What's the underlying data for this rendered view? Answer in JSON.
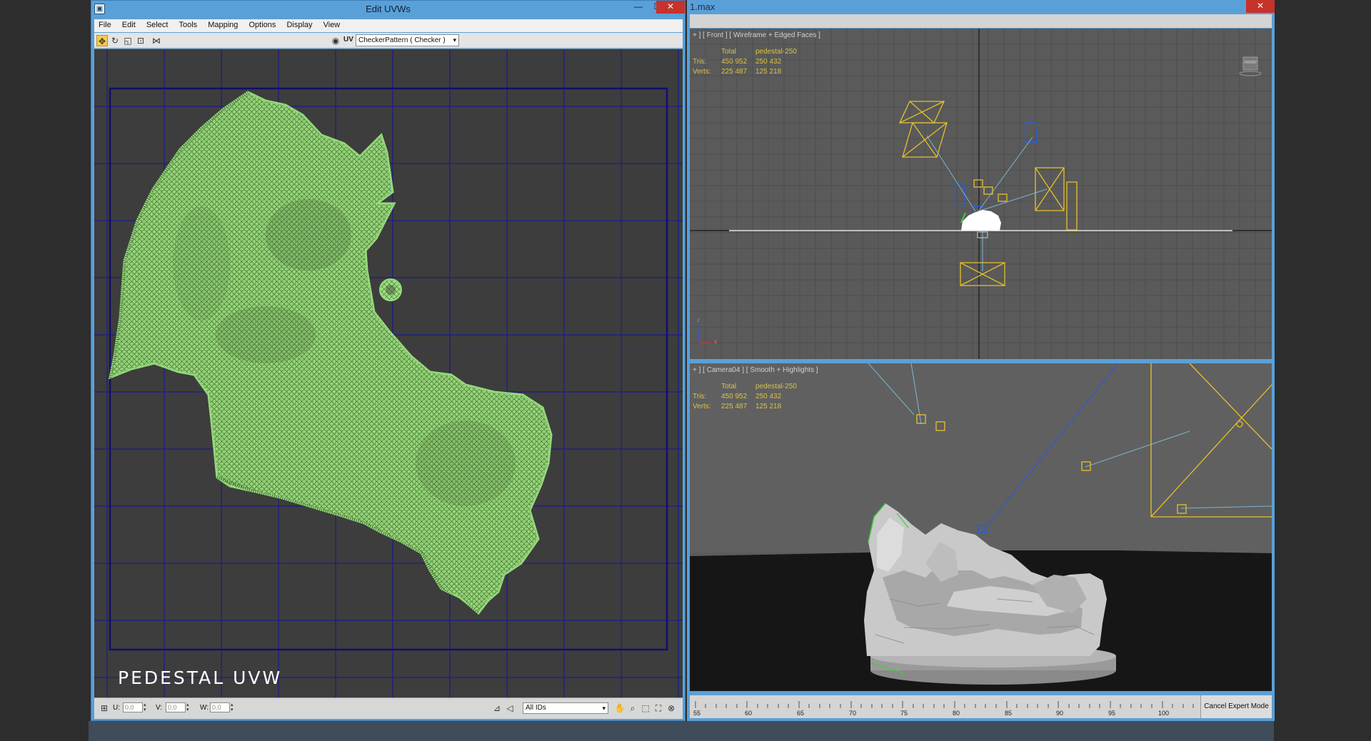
{
  "uvw_window": {
    "title": "Edit UVWs",
    "menu": [
      "File",
      "Edit",
      "Select",
      "Tools",
      "Mapping",
      "Options",
      "Display",
      "View"
    ],
    "uv_label": "UV",
    "texture_dropdown": "CheckerPattern  ( Checker )",
    "caption": "PEDESTAL UVW",
    "status": {
      "u_label": "U:",
      "u_value": "0,0",
      "v_label": "V:",
      "v_value": "0,0",
      "w_label": "W:",
      "w_value": "0,0",
      "ids_dropdown": "All IDs"
    },
    "colors": {
      "uv_mesh": "#9be07d",
      "grid_lines": "#1c1c8a",
      "canvas_bg": "#3d3d3d"
    }
  },
  "max_window": {
    "title": "1.max",
    "front_viewport": {
      "label": "+ ] [ Front ] [ Wireframe + Edged Faces ]",
      "stats": {
        "header_total": "Total",
        "header_object": "pedestal-250",
        "tris_label": "Tris:",
        "tris_total": "450 952",
        "tris_object": "250 432",
        "verts_label": "Verts:",
        "verts_total": "225 487",
        "verts_object": "125 218"
      },
      "axis_z": "z",
      "axis_x": "x",
      "viewcube_label": "FRONT"
    },
    "camera_viewport": {
      "label": "+ ] [ Camera04 ] [ Smooth + Highlights ]",
      "stats": {
        "header_total": "Total",
        "header_object": "pedestal-250",
        "tris_label": "Tris:",
        "tris_total": "450 952",
        "tris_object": "250 432",
        "verts_label": "Verts:",
        "verts_total": "225 487",
        "verts_object": "125 218"
      }
    },
    "timeline_ticks": [
      "55",
      "60",
      "65",
      "70",
      "75",
      "80",
      "85",
      "90",
      "95",
      "100"
    ],
    "cancel_expert_mode": "Cancel Expert Mode"
  }
}
